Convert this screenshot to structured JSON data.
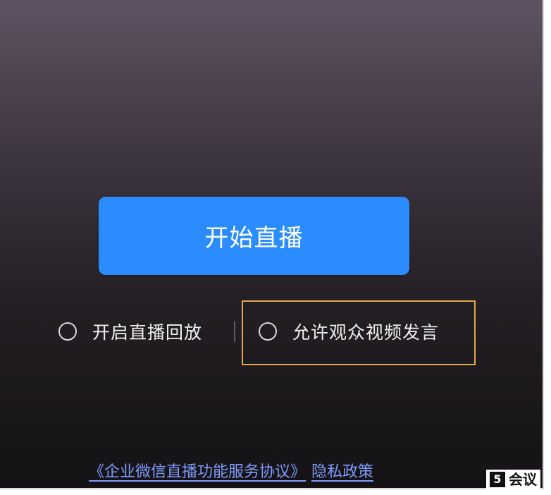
{
  "live": {
    "start_button_label": "开始直播",
    "options": [
      {
        "label": "开启直播回放",
        "checked": false
      },
      {
        "label": "允许观众视频发言",
        "checked": false
      }
    ]
  },
  "footer": {
    "agreement_link": "《企业微信直播功能服务协议》",
    "privacy_link": "隐私政策"
  },
  "watermark": {
    "mark": "5",
    "text": "会议"
  },
  "colors": {
    "primary_button": "#2b8cff",
    "highlight_border": "#e2a64b",
    "link": "#7f9cff"
  }
}
